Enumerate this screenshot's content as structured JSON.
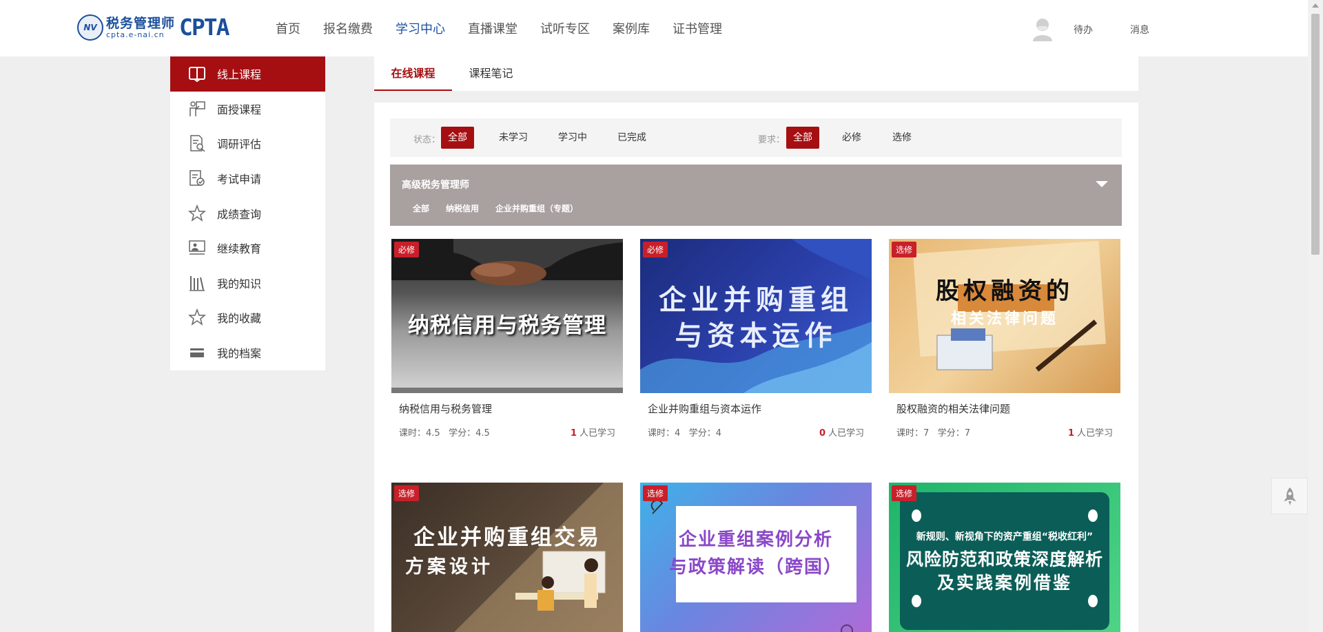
{
  "header": {
    "logo_cn": "税务管理师",
    "logo_url": "cpta.e-nai.cn",
    "logo_brand": "CPTA",
    "nav": [
      "首页",
      "报名缴费",
      "学习中心",
      "直播课堂",
      "试听专区",
      "案例库",
      "证书管理"
    ],
    "active_nav": "学习中心",
    "todo": "待办",
    "messages": "消息"
  },
  "sidebar": {
    "items": [
      {
        "label": "线上课程",
        "icon": "book-icon"
      },
      {
        "label": "面授课程",
        "icon": "teacher-icon"
      },
      {
        "label": "调研评估",
        "icon": "survey-icon"
      },
      {
        "label": "考试申请",
        "icon": "exam-icon"
      },
      {
        "label": "成绩查询",
        "icon": "star-icon"
      },
      {
        "label": "继续教育",
        "icon": "presentation-icon"
      },
      {
        "label": "我的知识",
        "icon": "library-icon"
      },
      {
        "label": "我的收藏",
        "icon": "star-outline-icon"
      },
      {
        "label": "我的档案",
        "icon": "card-icon"
      }
    ]
  },
  "tabs": [
    "在线课程",
    "课程笔记"
  ],
  "filters": {
    "status_label": "状态：",
    "status_options": [
      "全部",
      "未学习",
      "学习中",
      "已完成"
    ],
    "require_label": "要求：",
    "require_options": [
      "全部",
      "必修",
      "选修"
    ]
  },
  "category": {
    "title": "高级税务管理师",
    "subs": [
      "全部",
      "纳税信用",
      "企业并购重组（专题）"
    ]
  },
  "courses": [
    {
      "badge": "必修",
      "cover": "纳税信用与税务管理",
      "title": "纳税信用与税务管理",
      "hours_label": "课时：",
      "hours": "4.5",
      "credit_label": "学分：",
      "credit": "4.5",
      "learners": "1",
      "learners_label": "人已学习"
    },
    {
      "badge": "必修",
      "cover_line1": "企业并购重组",
      "cover_line2": "与资本运作",
      "title": "企业并购重组与资本运作",
      "hours_label": "课时：",
      "hours": "4",
      "credit_label": "学分：",
      "credit": "4",
      "learners": "0",
      "learners_label": "人已学习"
    },
    {
      "badge": "选修",
      "cover_line1": "股权融资的",
      "cover_line2": "相关法律问题",
      "title": "股权融资的相关法律问题",
      "hours_label": "课时：",
      "hours": "7",
      "credit_label": "学分：",
      "credit": "7",
      "learners": "1",
      "learners_label": "人已学习"
    },
    {
      "badge": "选修",
      "cover_line1": "企业并购重组交易",
      "cover_line2": "方案设计"
    },
    {
      "badge": "选修",
      "cover_line1": "企业重组案例分析",
      "cover_line2": "与政策解读（跨国）"
    },
    {
      "badge": "选修",
      "cover_small": "新规则、新视角下的资产重组“税收红利”",
      "cover_line1": "风险防范和政策深度解析",
      "cover_line2": "及实践案例借鉴"
    }
  ],
  "colors": {
    "brand_red": "#a50f12",
    "badge_red": "#c8202a",
    "nav_blue": "#1e4fa3",
    "category_bg": "#a9a0a0"
  }
}
